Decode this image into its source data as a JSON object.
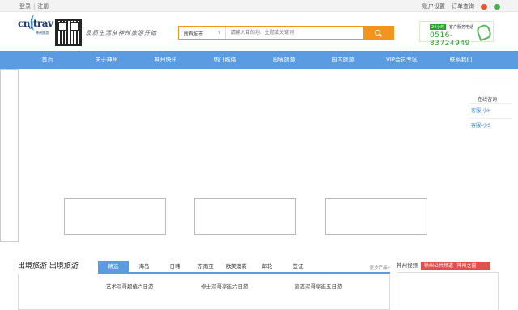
{
  "topbar": {
    "login": "登录",
    "register": "注册",
    "account_settings": "账户设置",
    "order_query": "订单查询"
  },
  "header": {
    "logo_text": "cnjtrav",
    "logo_sub": "神州旅游",
    "slogan": "品质生活从神州旅游开始",
    "search": {
      "city": "所有城市",
      "placeholder": "请输入目的地、主题或关键词"
    },
    "hotline": {
      "badge": "24小时",
      "label": "客户服务电话",
      "number": "0516-83724949"
    }
  },
  "nav": {
    "items": [
      "首页",
      "关于神州",
      "神州快讯",
      "热门线路",
      "出境旅游",
      "国内旅游",
      "VIP会员专区",
      "联系我们"
    ]
  },
  "online_service": {
    "title": "在线咨询",
    "agents": [
      "客服-小H",
      "客服-小S"
    ]
  },
  "section": {
    "title": "出境旅游 出境旅游",
    "tabs": [
      "精选",
      "海岛",
      "日韩",
      "东南亚",
      "欧美澳新",
      "邮轮",
      "签证"
    ],
    "more": "更多产品»",
    "products": [
      "艺术深哥超值六日游",
      "修士深哥享逛六日游",
      "姿态深哥享逛五日游"
    ]
  },
  "side": {
    "title": "神州视频",
    "tag": "徐州公共频道--神州之窗"
  },
  "colors": {
    "nav_blue": "#5a9be2",
    "search_orange": "#f39320",
    "hotline_green": "#2e9e2e",
    "tag_red": "#e05050"
  }
}
